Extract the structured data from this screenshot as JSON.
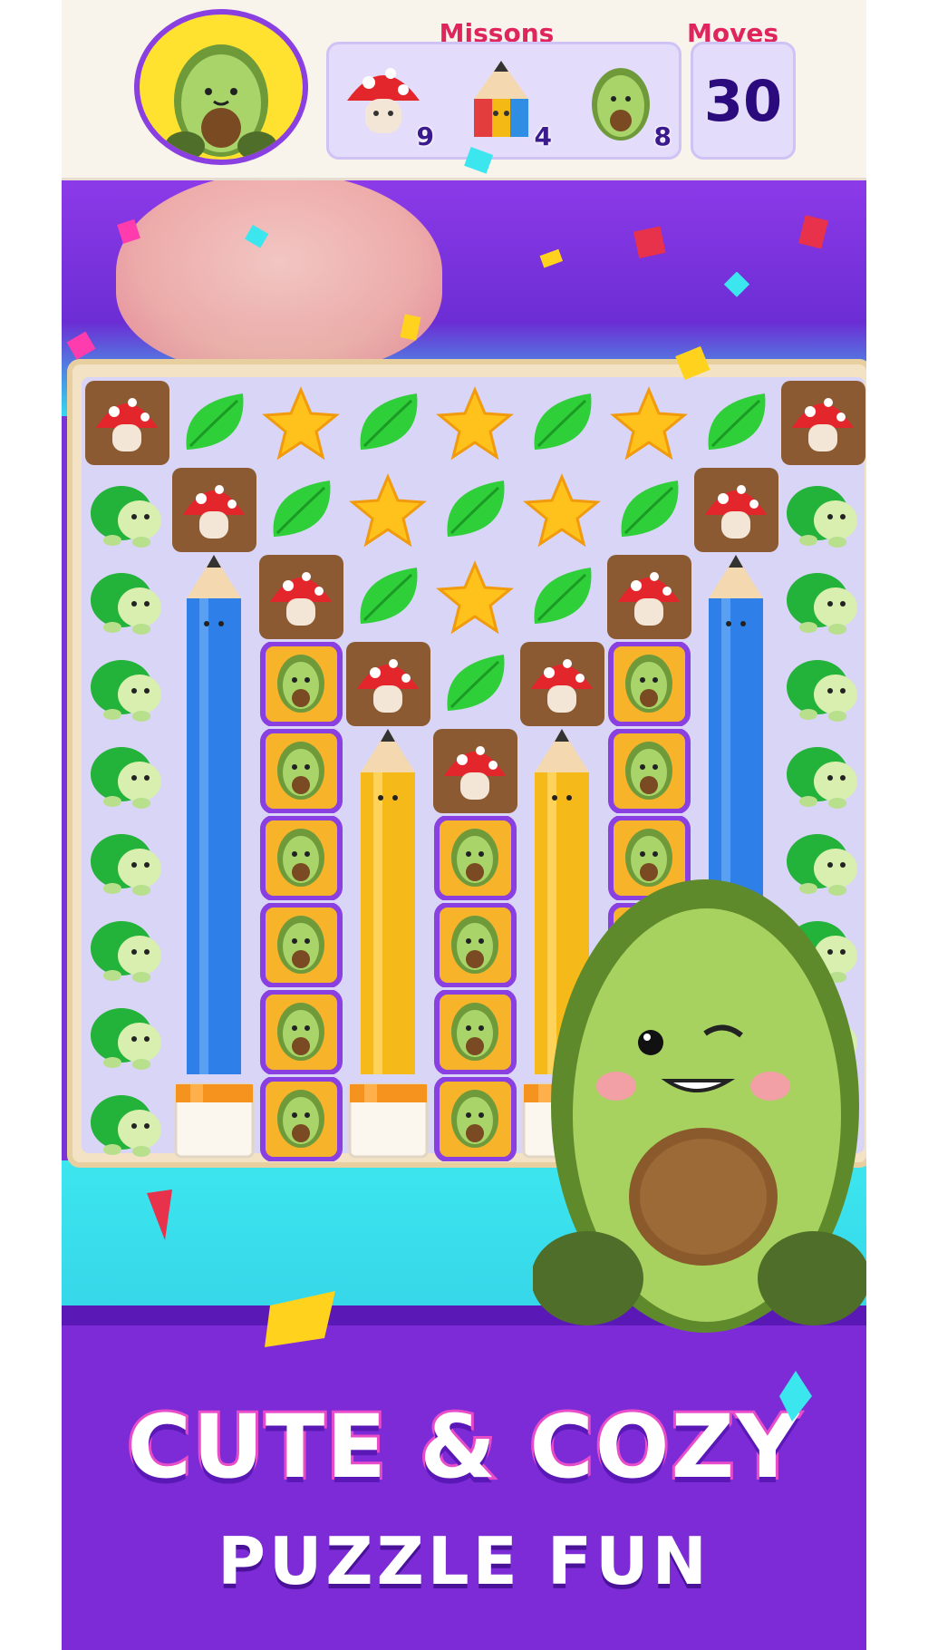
{
  "header": {
    "missions_label": "Missons",
    "moves_label": "Moves",
    "moves_value": "30",
    "missions": [
      {
        "icon": "mushroom-icon",
        "count": "9"
      },
      {
        "icon": "pencil-icon",
        "count": "4"
      },
      {
        "icon": "avocado-icon",
        "count": "8"
      }
    ]
  },
  "colors": {
    "accent_purple": "#7c2bd6",
    "missions_red": "#e0245e",
    "moves_navy": "#2b0a7e",
    "panel_lavender": "#e4dcfb",
    "avatar_yellow": "#ffe230",
    "board_tan": "#f3e2c3",
    "cyan": "#3ce6ef"
  },
  "board": {
    "rows": [
      [
        "mushroom",
        "leaf",
        "star",
        "leaf",
        "star",
        "leaf",
        "star",
        "leaf",
        "mushroom"
      ],
      [
        "turtle",
        "mushroom",
        "leaf",
        "star",
        "leaf",
        "star",
        "leaf",
        "mushroom",
        "turtle"
      ],
      [
        "turtle",
        "pencil-blue",
        "mushroom",
        "leaf",
        "star",
        "leaf",
        "mushroom",
        "pencil-blue",
        "turtle"
      ],
      [
        "turtle",
        "pencil-blue",
        "avocado-wrap",
        "mushroom",
        "leaf",
        "mushroom",
        "avocado-wrap",
        "pencil-blue",
        "turtle"
      ],
      [
        "turtle",
        "pencil-blue",
        "avocado-wrap",
        "pencil-yellow",
        "mushroom",
        "pencil-yellow",
        "avocado-wrap",
        "pencil-blue",
        "turtle"
      ],
      [
        "turtle",
        "pencil-blue",
        "avocado-wrap",
        "pencil-yellow",
        "avocado-wrap",
        "pencil-yellow",
        "avocado-wrap",
        "pencil-blue",
        "turtle"
      ],
      [
        "turtle",
        "pencil-blue",
        "avocado-wrap",
        "pencil-yellow",
        "avocado-wrap",
        "pencil-yellow",
        "avocado-wrap",
        "pencil-blue",
        "turtle"
      ],
      [
        "turtle",
        "pencil-blue",
        "avocado-wrap",
        "pencil-yellow",
        "avocado-wrap",
        "pencil-yellow",
        "avocado-wrap",
        "pencil-blue",
        "turtle"
      ],
      [
        "turtle",
        "crate",
        "avocado-wrap",
        "crate",
        "avocado-wrap",
        "crate",
        "avocado-wrap",
        "pencil-blue",
        "turtle"
      ]
    ]
  },
  "promo": {
    "line1": "CUTE & COZY",
    "line2": "PUZZLE FUN"
  }
}
